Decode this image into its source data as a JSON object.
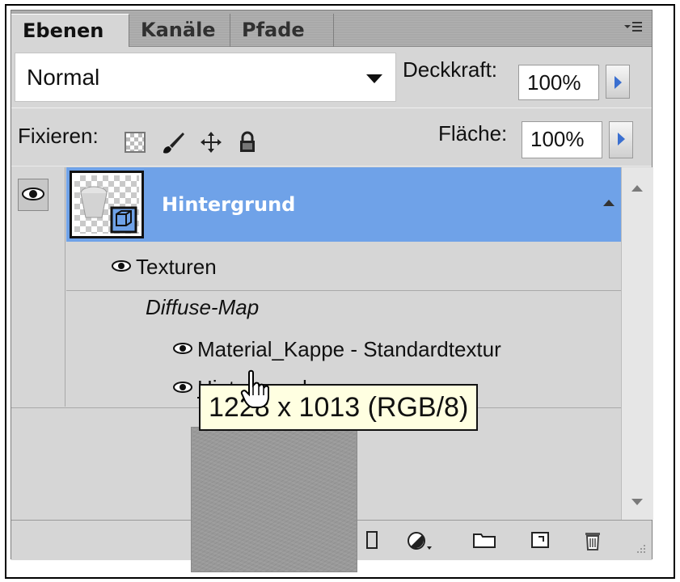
{
  "tabs": [
    {
      "label": "Ebenen",
      "active": true
    },
    {
      "label": "Kanäle",
      "active": false
    },
    {
      "label": "Pfade",
      "active": false
    }
  ],
  "panel_menu_icon": "panel-menu-icon",
  "blend_mode": {
    "value": "Normal"
  },
  "opacity": {
    "label": "Deckkraft:",
    "value": "100%"
  },
  "lock": {
    "label": "Fixieren:",
    "icons": [
      "lock-transparency-icon",
      "lock-paint-icon",
      "lock-position-icon",
      "lock-all-icon"
    ]
  },
  "fill": {
    "label": "Fläche:",
    "value": "100%"
  },
  "layers": [
    {
      "name": "Hintergrund",
      "selected": true,
      "visible": true,
      "children": {
        "group_label": "Texturen",
        "map_label": "Diffuse-Map",
        "items": [
          "Material_Kappe - Standardtextur",
          "Hintergrund"
        ]
      }
    }
  ],
  "tooltip": {
    "text": "1228 x 1013 (RGB/8)"
  },
  "bottom_icons": [
    "mask-icon",
    "adjustment-layer-icon",
    "new-group-icon",
    "new-layer-icon",
    "trash-icon"
  ],
  "colors": {
    "selection": "#6fa2e8",
    "panel": "#d6d6d6",
    "tooltip_bg": "#ffffe1",
    "accent_arrow": "#3a6fd0"
  }
}
